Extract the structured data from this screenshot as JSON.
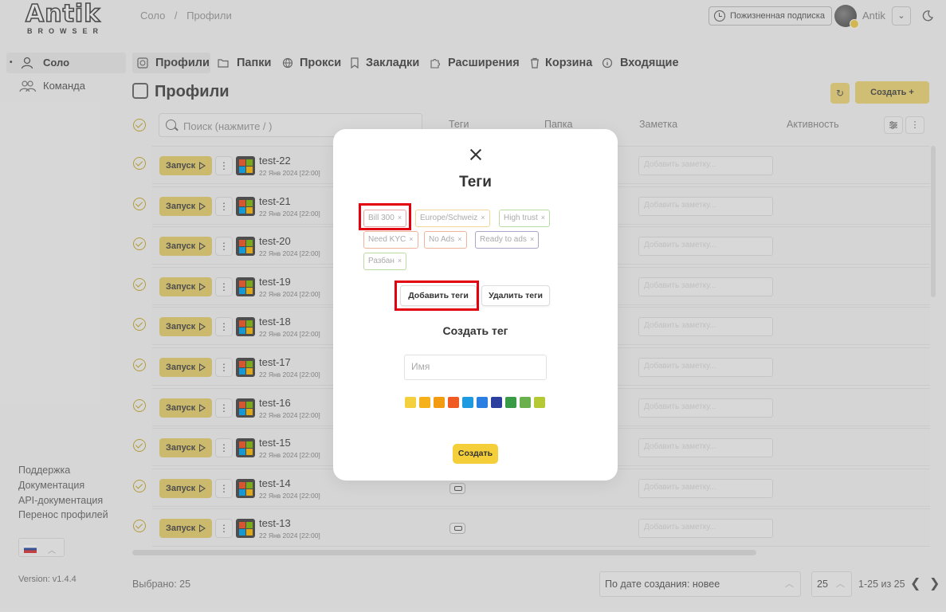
{
  "logo": {
    "main": "Antik",
    "sub": "BROWSER"
  },
  "breadcrumb": {
    "a": "Соло",
    "sep": "/",
    "b": "Профили"
  },
  "header": {
    "subscription": "Пожизненная подписка",
    "user": "Antik",
    "chevron": "⌄",
    "theme_icon": "moon-icon"
  },
  "sidebar": {
    "items": [
      {
        "label": "Соло",
        "bullet": "•",
        "icon": "user-icon"
      },
      {
        "label": "Команда",
        "icon": "team-icon"
      }
    ],
    "footer_links": [
      "Поддержка",
      "Документация",
      "API-документация",
      "Перенос профилей"
    ],
    "version": "Version: v1.4.4"
  },
  "tabs": [
    {
      "label": "Профили",
      "icon": "fingerprint-icon"
    },
    {
      "label": "Папки",
      "icon": "folder-icon"
    },
    {
      "label": "Прокси",
      "icon": "globe-icon"
    },
    {
      "label": "Закладки",
      "icon": "bookmark-icon"
    },
    {
      "label": "Расширения",
      "icon": "puzzle-icon"
    },
    {
      "label": "Корзина",
      "icon": "trash-icon"
    },
    {
      "label": "Входящие",
      "icon": "info-icon"
    }
  ],
  "page": {
    "title": "Профили",
    "create": "Создать +",
    "refresh_icon": "refresh-icon"
  },
  "table": {
    "search_placeholder": "Поиск (нажмите / )",
    "columns": {
      "tags": "Теги",
      "folder": "Папка",
      "note": "Заметка",
      "activity": "Активность"
    },
    "run_label": "Запуск",
    "kebab": "⋮",
    "note_placeholder": "Добавить заметку...",
    "rows": [
      {
        "name": "test-22",
        "date": "22 Янв 2024 [22:00]"
      },
      {
        "name": "test-21",
        "date": "22 Янв 2024 [22:00]"
      },
      {
        "name": "test-20",
        "date": "22 Янв 2024 [22:00]"
      },
      {
        "name": "test-19",
        "date": "22 Янв 2024 [22:00]"
      },
      {
        "name": "test-18",
        "date": "22 Янв 2024 [22:00]"
      },
      {
        "name": "test-17",
        "date": "22 Янв 2024 [22:00]"
      },
      {
        "name": "test-16",
        "date": "22 Янв 2024 [22:00]"
      },
      {
        "name": "test-15",
        "date": "22 Янв 2024 [22:00]"
      },
      {
        "name": "test-14",
        "date": "22 Янв 2024 [22:00]"
      },
      {
        "name": "test-13",
        "date": "22 Янв 2024 [22:00]"
      }
    ]
  },
  "footer": {
    "selected": "Выбрано: 25",
    "sort": "По дате создания: новее",
    "per_page": "25",
    "range": "1-25 из 25",
    "prev": "❮",
    "next": "❯",
    "chev_up": "︿"
  },
  "modal": {
    "title": "Теги",
    "tags": [
      {
        "label": "Bill 300",
        "color": "#e6a4a0"
      },
      {
        "label": "Europe/Schweiz",
        "color": "#f2d896"
      },
      {
        "label": "High trust",
        "color": "#b9dda0"
      },
      {
        "label": "Need KYC",
        "color": "#f0b49a"
      },
      {
        "label": "No Ads",
        "color": "#f0b49a"
      },
      {
        "label": "Ready to ads",
        "color": "#a9a6c9"
      },
      {
        "label": "Разбан",
        "color": "#b9dda0"
      }
    ],
    "tag_remove": "×",
    "add_tags": "Добавить теги",
    "remove_tags": "Удалить теги",
    "create_tag_title": "Создать тег",
    "name_placeholder": "Имя",
    "colors": [
      "#f4d03f",
      "#f5b01a",
      "#f39c12",
      "#f05a23",
      "#1e9be0",
      "#2b7fe3",
      "#2c3e9e",
      "#3a9b47",
      "#6ab04c",
      "#b5c935"
    ],
    "create": "Создать",
    "highlight_color": "#e3000f"
  }
}
